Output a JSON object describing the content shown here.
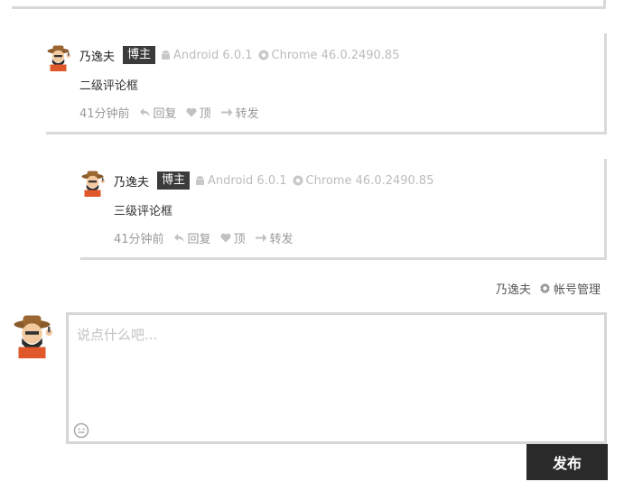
{
  "comments": [
    {
      "author": "乃逸夫",
      "badge": "博主",
      "os": "Android 6.0.1",
      "browser": "Chrome 46.0.2490.85",
      "text": "二级评论框",
      "time": "41分钟前",
      "reply_label": "回复",
      "top_label": "顶",
      "forward_label": "转发"
    },
    {
      "author": "乃逸夫",
      "badge": "博主",
      "os": "Android 6.0.1",
      "browser": "Chrome 46.0.2490.85",
      "text": "三级评论框",
      "time": "41分钟前",
      "reply_label": "回复",
      "top_label": "顶",
      "forward_label": "转发"
    }
  ],
  "account": {
    "username": "乃逸夫",
    "manage_label": "帐号管理"
  },
  "compose": {
    "placeholder": "说点什么吧...",
    "value": "",
    "publish_label": "发布"
  },
  "icons": {
    "os": "android-icon",
    "browser": "chrome-icon",
    "reply": "reply-arrow-icon",
    "like": "heart-icon",
    "forward": "forward-arrow-icon",
    "settings": "gear-icon",
    "emoji": "smiley-icon"
  },
  "colors": {
    "badge_bg": "#3b3b3b",
    "publish_bg": "#2a2a2a",
    "meta_text": "#bcbcbc",
    "action_text": "#9a9a9a"
  }
}
